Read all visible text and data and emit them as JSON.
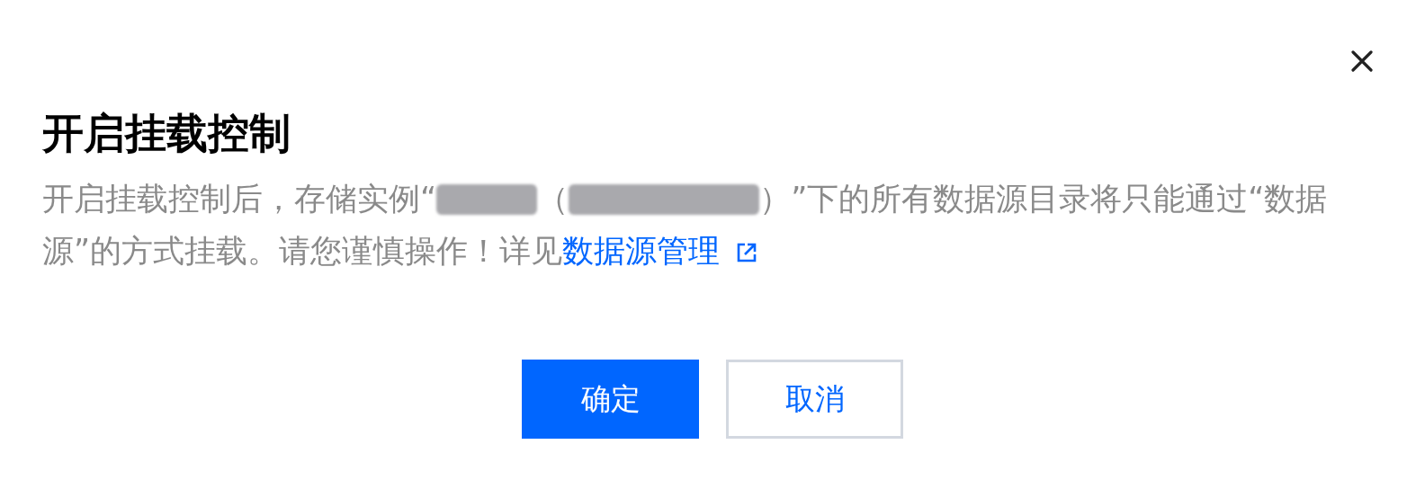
{
  "dialog": {
    "title": "开启挂载控制",
    "message": [
      {
        "kind": "text",
        "text": "开启挂载控制后，存储实例“"
      },
      {
        "kind": "redacted"
      },
      {
        "kind": "text",
        "text": "（"
      },
      {
        "kind": "redacted"
      },
      {
        "kind": "text",
        "text": "）”下的所有数据源目录将只能通过“数据源”的方式挂载。请您谨慎操作！详见"
      },
      {
        "kind": "link",
        "text": "数据源管理"
      }
    ],
    "buttons": [
      {
        "label": "确定",
        "primary": true
      },
      {
        "label": "取消",
        "primary": false
      }
    ]
  }
}
